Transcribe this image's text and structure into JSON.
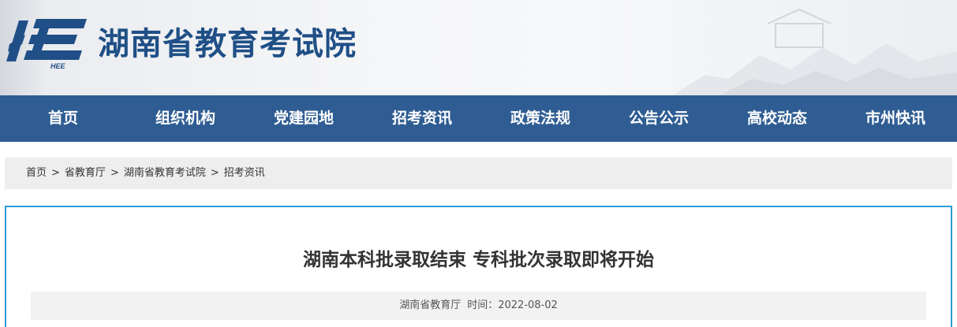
{
  "header": {
    "site_name": "湖南省教育考试院",
    "logo_text": "HEE"
  },
  "nav": {
    "items": [
      {
        "label": "首页"
      },
      {
        "label": "组织机构"
      },
      {
        "label": "党建园地"
      },
      {
        "label": "招考资讯"
      },
      {
        "label": "政策法规"
      },
      {
        "label": "公告公示"
      },
      {
        "label": "高校动态"
      },
      {
        "label": "市州快讯"
      }
    ]
  },
  "breadcrumb": {
    "items": [
      {
        "label": "首页"
      },
      {
        "label": "省教育厅"
      },
      {
        "label": "湖南省教育考试院"
      },
      {
        "label": "招考资讯"
      }
    ],
    "separator": ">"
  },
  "article": {
    "title": "湖南本科批录取结束 专科批次录取即将开始",
    "source": "湖南省教育厅",
    "time_label": "时间：",
    "date": "2022-08-02"
  },
  "colors": {
    "brand_blue": "#1f4f86",
    "nav_background": "#2f5d93",
    "panel_border": "#2a9fd6"
  }
}
